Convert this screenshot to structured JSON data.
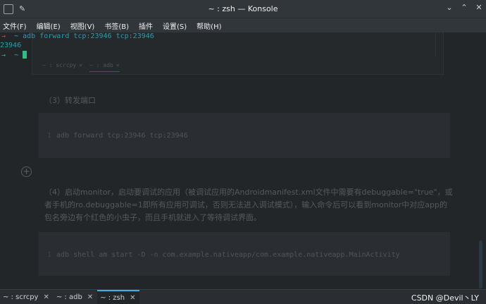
{
  "window": {
    "title": "~ : zsh — Konsole",
    "pin_icon": "pin-icon",
    "controls": [
      "chevron-down-icon",
      "chevron-up-icon",
      "close-icon"
    ]
  },
  "menu": {
    "items": [
      "文件(F)",
      "编辑(E)",
      "视图(V)",
      "书签(B)",
      "插件",
      "设置(S)",
      "帮助(H)"
    ]
  },
  "terminal": {
    "line1": {
      "arrow": "→",
      "tilde": "~",
      "command": "adb forward tcp:23946 tcp:23946"
    },
    "line2": {
      "output": "23946"
    },
    "line3": {
      "arrow": "→",
      "tilde": "~"
    }
  },
  "background_page": {
    "inner_tabs": [
      "~ : scrcpy",
      "~ : adb"
    ],
    "section3_title": "（3）转发端口",
    "code1": {
      "line_no": "1",
      "text": "adb forward tcp:23946 tcp:23946"
    },
    "section4_text": "（4）启动monitor，启动要调试的应用（被调试应用的Androidmanifest.xml文件中需要有debuggable=\"true\"，或者手机的ro.debuggable=1即所有应用可调试，否则无法进入调试模式），输入命令后可以看到monitor中对应app的包名旁边有个红色的小虫子，而且手机就进入了等待调试界面。",
    "code2": {
      "line_no": "1",
      "text": "adb shell am start -D -n com.example.nativeapp/com.example.nativeapp.MainActivity"
    }
  },
  "tabs": [
    {
      "label": "~ : scrcpy",
      "active": false
    },
    {
      "label": "~ : adb",
      "active": false
    },
    {
      "label": "~ : zsh",
      "active": true
    }
  ],
  "watermark": "CSDN @Devil丶LY",
  "colors": {
    "accent": "#3daee9",
    "prompt_arrow": "#d04040",
    "prompt_tilde": "#22b6c6",
    "cursor": "#2bbf8a"
  }
}
